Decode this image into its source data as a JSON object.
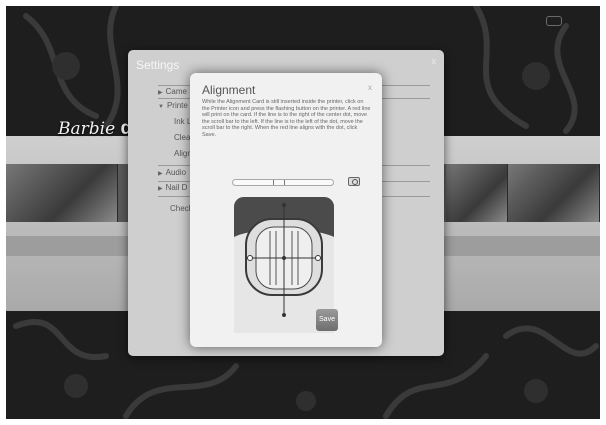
{
  "app": {
    "brand_script": "Barbie",
    "brand_bold": "do"
  },
  "settings": {
    "title": "Settings",
    "close": "x",
    "items": [
      {
        "label": "Came",
        "expand": "▶"
      },
      {
        "label": "Printe",
        "expand": "▼"
      },
      {
        "label": "Ink L",
        "expand": ""
      },
      {
        "label": "Cleani",
        "expand": ""
      },
      {
        "label": "Align",
        "expand": ""
      },
      {
        "label": "Audio",
        "expand": "▶"
      },
      {
        "label": "Nail D",
        "expand": "▶"
      },
      {
        "label": "Check",
        "expand": ""
      }
    ]
  },
  "alignment": {
    "title": "Alignment",
    "close": "x",
    "instructions": "While the Alignment Card is still inserted inside the printer, click on the Printer icon and press the flashing button on the printer. A red line will print on the card. If the line is to the right of the center dot, move the scroll bar to the left. If the line is to the left of the dot, move the scroll bar to the right. When the red line aligns with the dot, click Save.",
    "save_label": "Save",
    "camera_icon": "camera-icon",
    "scroll_position": 0.45
  },
  "colors": {
    "backdrop": "#1d1d1d",
    "dialog": "#cfcfcf",
    "alignment_panel": "#f1f1f1"
  }
}
